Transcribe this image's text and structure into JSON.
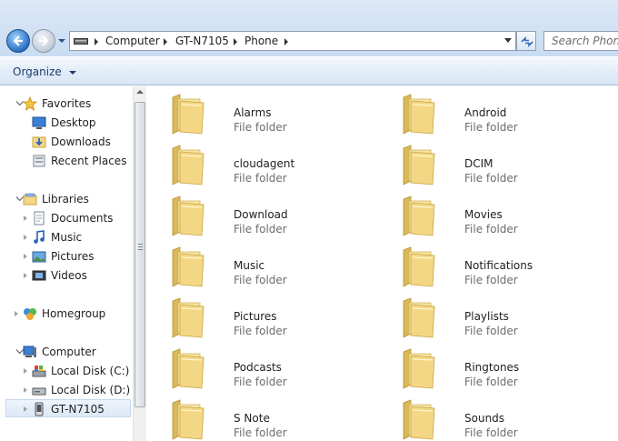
{
  "address": {
    "crumbs": [
      "Computer",
      "GT-N7105",
      "Phone"
    ],
    "search_placeholder": "Search Phone"
  },
  "toolbar": {
    "organize_label": "Organize"
  },
  "sidebar": {
    "favorites": {
      "label": "Favorites",
      "items": [
        "Desktop",
        "Downloads",
        "Recent Places"
      ]
    },
    "libraries": {
      "label": "Libraries",
      "items": [
        "Documents",
        "Music",
        "Pictures",
        "Videos"
      ]
    },
    "homegroup": {
      "label": "Homegroup"
    },
    "computer": {
      "label": "Computer",
      "items": [
        "Local Disk (C:)",
        "Local Disk (D:)",
        "GT-N7105"
      ]
    }
  },
  "folders": [
    {
      "name": "Alarms",
      "type": "File folder"
    },
    {
      "name": "Android",
      "type": "File folder"
    },
    {
      "name": "cloudagent",
      "type": "File folder"
    },
    {
      "name": "DCIM",
      "type": "File folder"
    },
    {
      "name": "Download",
      "type": "File folder"
    },
    {
      "name": "Movies",
      "type": "File folder"
    },
    {
      "name": "Music",
      "type": "File folder"
    },
    {
      "name": "Notifications",
      "type": "File folder"
    },
    {
      "name": "Pictures",
      "type": "File folder"
    },
    {
      "name": "Playlists",
      "type": "File folder"
    },
    {
      "name": "Podcasts",
      "type": "File folder"
    },
    {
      "name": "Ringtones",
      "type": "File folder"
    },
    {
      "name": "S Note",
      "type": "File folder"
    },
    {
      "name": "Sounds",
      "type": "File folder"
    }
  ],
  "colors": {
    "folder": "#f3d784",
    "selection": "#dbe8f6",
    "link_text": "#1e3c6e"
  }
}
